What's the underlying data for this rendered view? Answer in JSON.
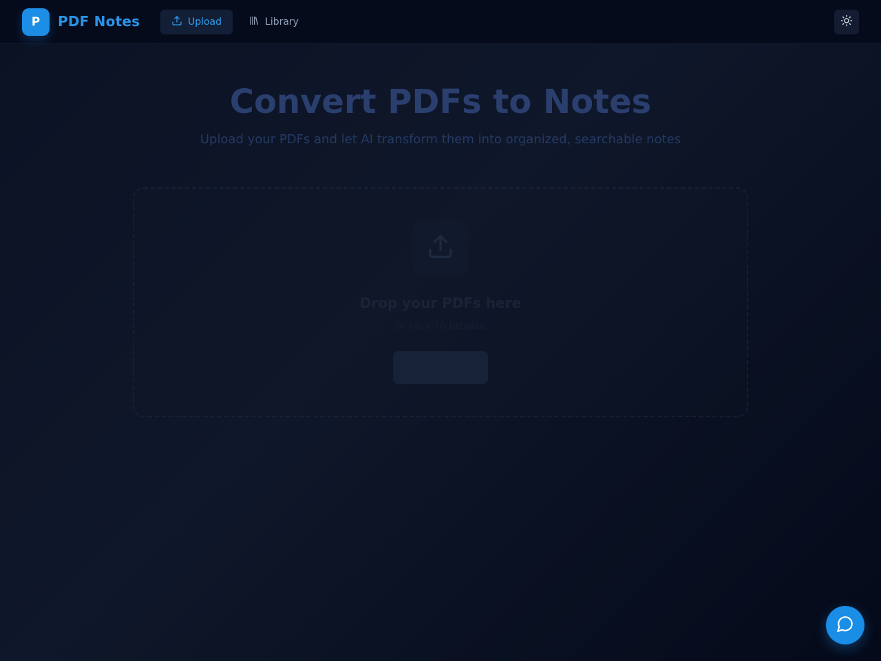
{
  "app": {
    "logo_letter": "P",
    "name": "PDF Notes"
  },
  "nav": {
    "upload_label": "Upload",
    "upload_icon": "upload-icon",
    "library_label": "Library",
    "library_icon": "library-icon",
    "active": "Upload"
  },
  "theme_toggle_icon": "sun-icon",
  "hero": {
    "title": "Convert PDFs to Notes",
    "subtitle": "Upload your PDFs and let AI transform them into organized, searchable notes"
  },
  "dropzone": {
    "icon": "upload-icon",
    "title": "Drop your PDFs here",
    "subtitle": "or click to browse",
    "button_label": ""
  },
  "chat_button_icon": "chat-bubble-icon",
  "colors": {
    "accent": "#1d8ee6",
    "background": "#0f172a",
    "topbar": "#060b1c"
  }
}
